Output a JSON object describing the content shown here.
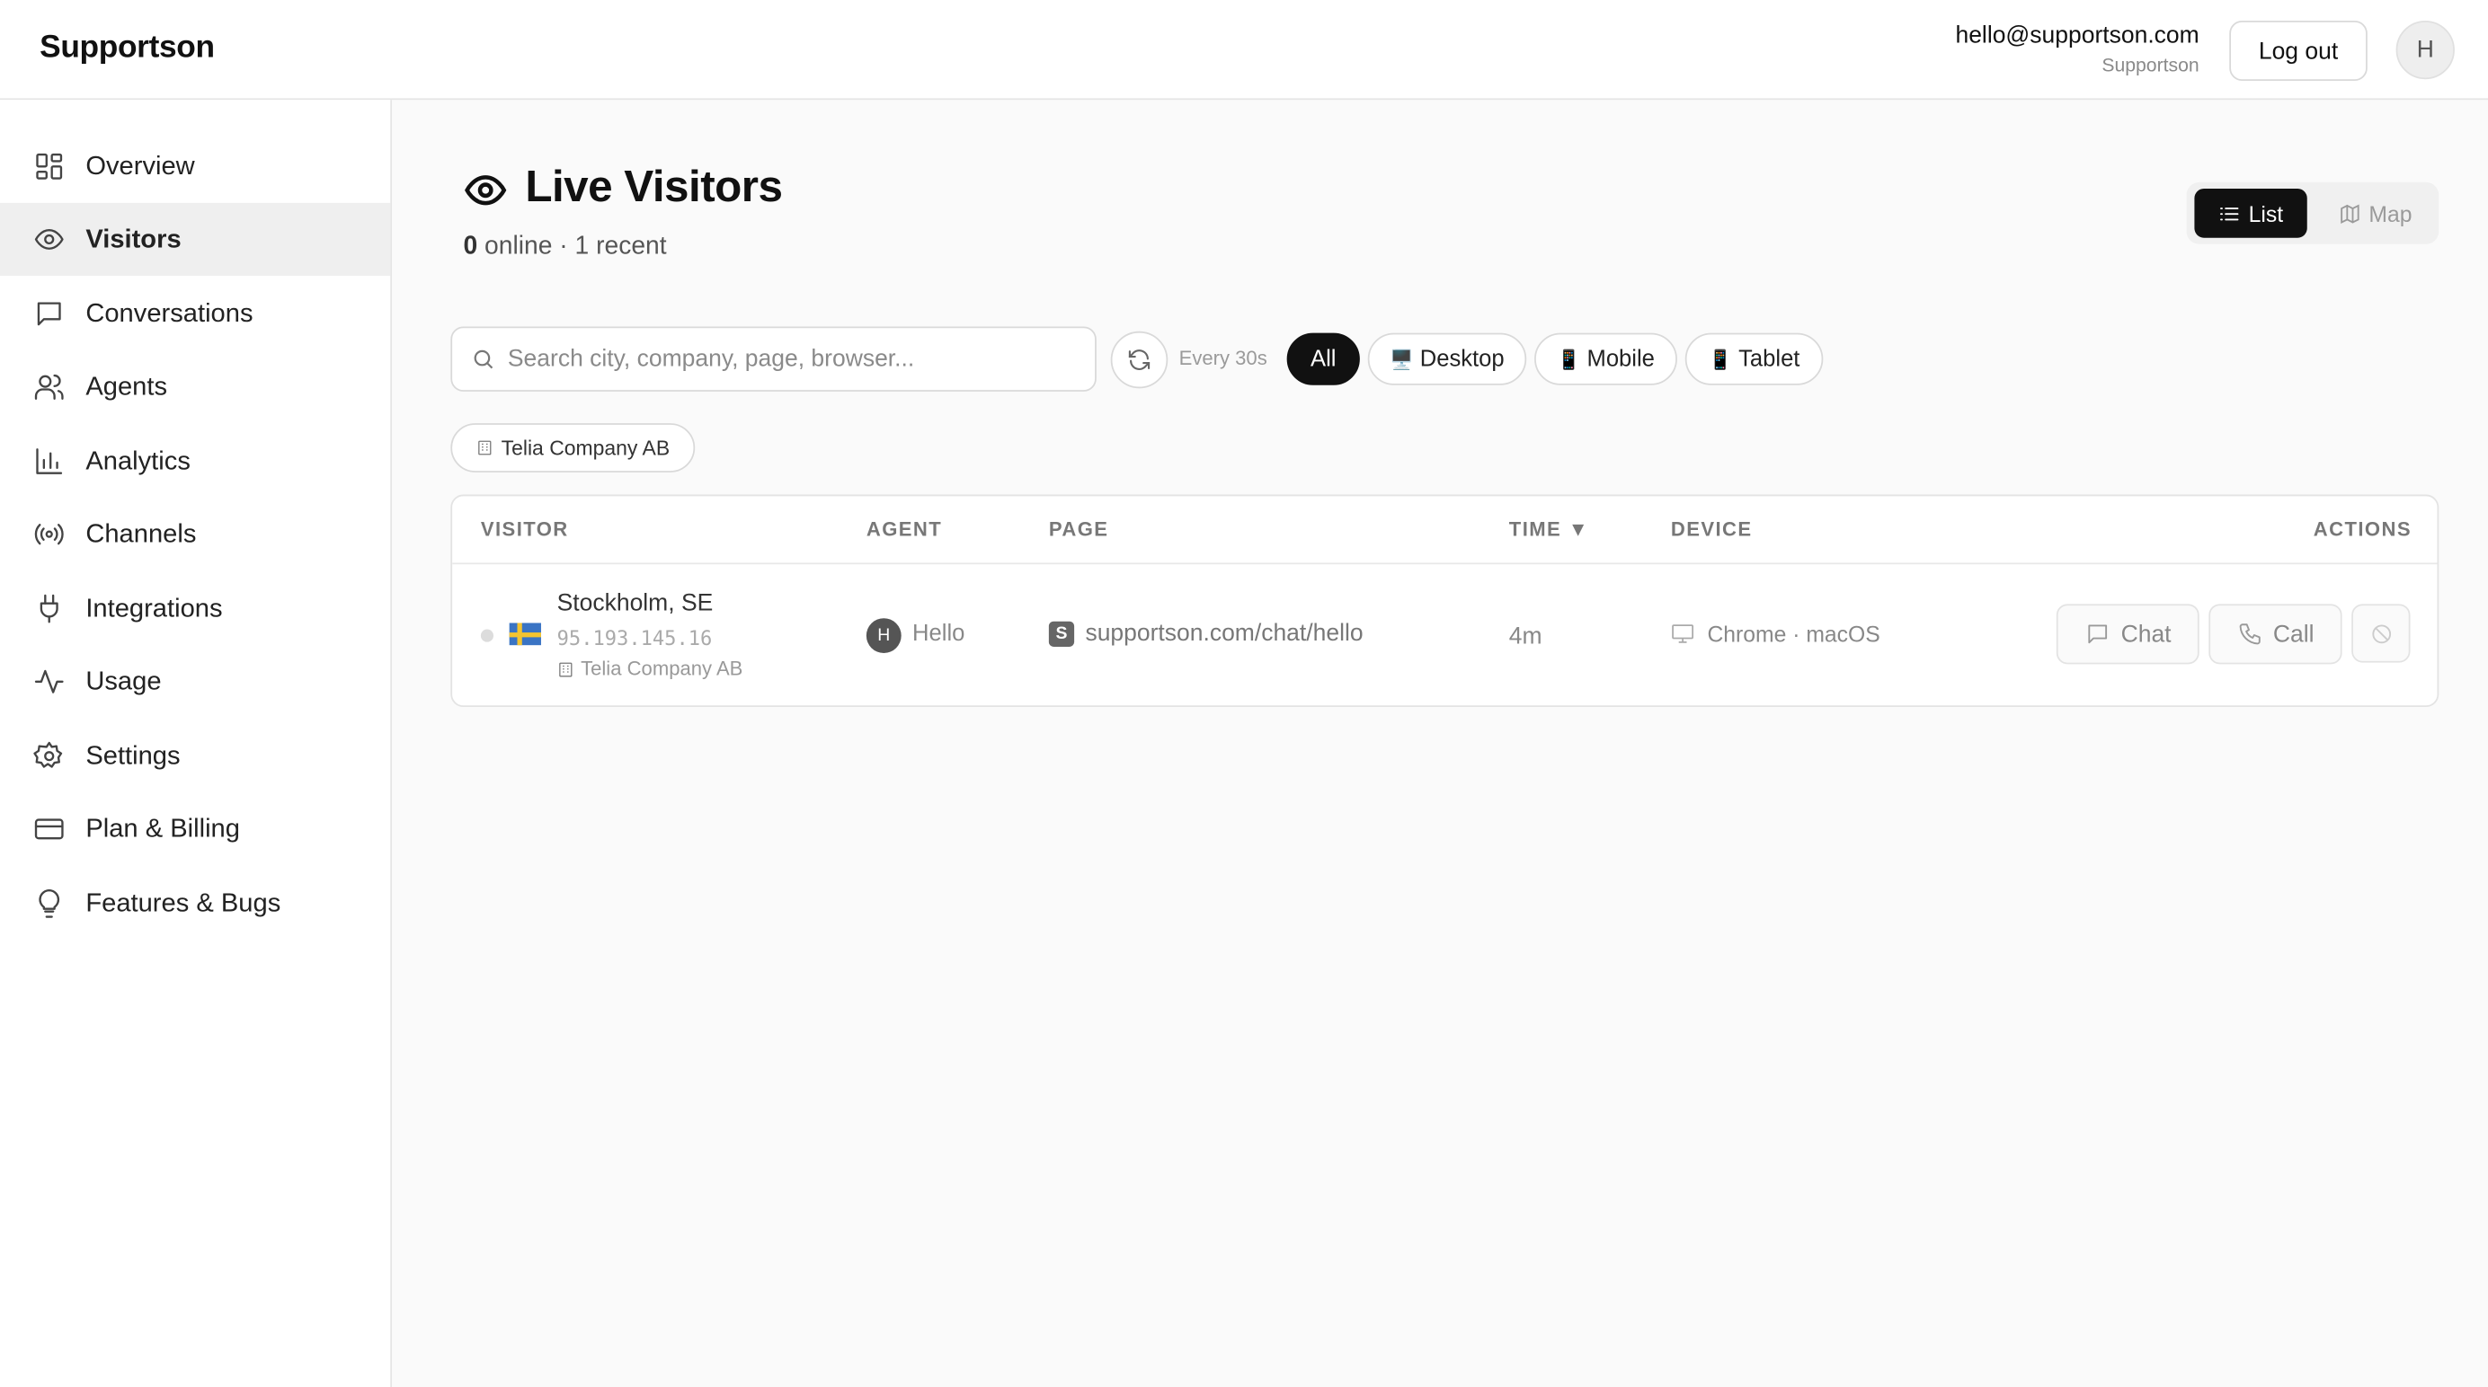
{
  "app": {
    "brand": "Supportson"
  },
  "account": {
    "email": "hello@supportson.com",
    "org": "Supportson",
    "logout_label": "Log out",
    "avatar_initial": "H"
  },
  "sidebar": {
    "items": [
      {
        "label": "Overview",
        "icon": "grid-icon"
      },
      {
        "label": "Visitors",
        "icon": "eye-icon",
        "active": true
      },
      {
        "label": "Conversations",
        "icon": "chat-bubble-icon"
      },
      {
        "label": "Agents",
        "icon": "users-icon"
      },
      {
        "label": "Analytics",
        "icon": "bar-chart-icon"
      },
      {
        "label": "Channels",
        "icon": "broadcast-icon"
      },
      {
        "label": "Integrations",
        "icon": "plug-icon"
      },
      {
        "label": "Usage",
        "icon": "activity-icon"
      },
      {
        "label": "Settings",
        "icon": "gear-icon"
      },
      {
        "label": "Plan & Billing",
        "icon": "credit-card-icon"
      },
      {
        "label": "Features & Bugs",
        "icon": "lightbulb-icon"
      }
    ]
  },
  "main": {
    "title": "Live Visitors",
    "online_count": "0",
    "online_suffix": " online · 1 recent",
    "view_toggle": {
      "list_label": "List",
      "map_label": "Map",
      "selected": "List"
    },
    "search": {
      "placeholder": "Search city, company, page, browser...",
      "value": ""
    },
    "refresh_label": "Every 30s",
    "filters": [
      {
        "label": "All",
        "icon": "",
        "selected": true
      },
      {
        "label": "Desktop",
        "icon": "🖥️"
      },
      {
        "label": "Mobile",
        "icon": "📱"
      },
      {
        "label": "Tablet",
        "icon": "📱"
      }
    ],
    "company_filter": "Telia Company AB",
    "table": {
      "columns": [
        "VISITOR",
        "AGENT",
        "PAGE",
        "TIME ▼",
        "DEVICE",
        "ACTIONS"
      ],
      "rows": [
        {
          "city": "Stockholm, SE",
          "ip": "95.193.145.16",
          "company": "Telia Company AB",
          "agent_initial": "H",
          "agent_name": "Hello",
          "page_favicon": "S",
          "page": "supportson.com/chat/hello",
          "time": "4m",
          "device": "Chrome · macOS",
          "chat_label": "Chat",
          "call_label": "Call"
        }
      ]
    }
  }
}
